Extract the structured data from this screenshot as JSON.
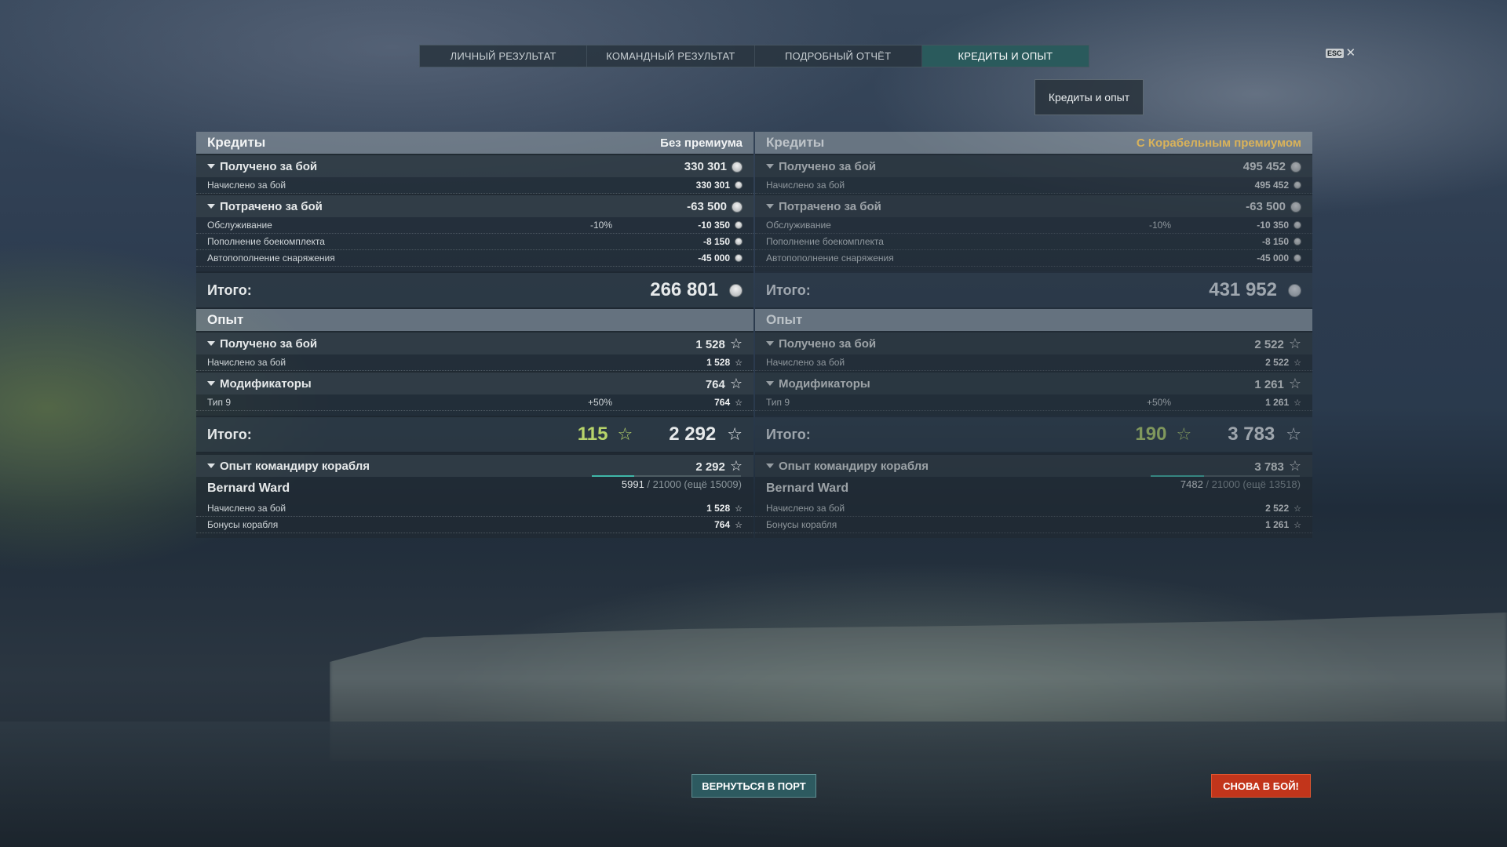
{
  "tabs": [
    "ЛИЧНЫЙ РЕЗУЛЬТАТ",
    "КОМАНДНЫЙ РЕЗУЛЬТАТ",
    "ПОДРОБНЫЙ ОТЧЁТ",
    "КРЕДИТЫ И ОПЫТ"
  ],
  "active_tab": "КРЕДИТЫ И ОПЫТ",
  "esc": {
    "key": "ESC",
    "close": "✕"
  },
  "chip": "Кредиты и опыт",
  "left": {
    "credits_title": "Кредиты",
    "mode": "Без премиума",
    "earned": {
      "label": "Получено за бой",
      "value": "330 301"
    },
    "earned_rows": [
      {
        "label": "Начислено за бой",
        "value": "330 301"
      }
    ],
    "spent": {
      "label": "Потрачено за бой",
      "value": "-63 500"
    },
    "spent_rows": [
      {
        "label": "Обслуживание",
        "pct": "-10%",
        "value": "-10 350"
      },
      {
        "label": "Пополнение боекомплекта",
        "pct": "",
        "value": "-8 150"
      },
      {
        "label": "Автопополнение снаряжения",
        "pct": "",
        "value": "-45 000"
      }
    ],
    "credits_total": {
      "label": "Итого:",
      "value": "266 801"
    },
    "xp_title": "Опыт",
    "xp_earned": {
      "label": "Получено за бой",
      "value": "1 528"
    },
    "xp_earned_rows": [
      {
        "label": "Начислено за бой",
        "value": "1 528"
      }
    ],
    "modifiers": {
      "label": "Модификаторы",
      "value": "764"
    },
    "modifier_rows": [
      {
        "label": "Тип 9",
        "pct": "+50%",
        "value": "764"
      }
    ],
    "xp_total": {
      "label": "Итого:",
      "free": "115",
      "value": "2 292"
    },
    "commander_xp": {
      "label": "Опыт командиру корабля",
      "value": "2 292"
    },
    "commander": {
      "name": "Bernard Ward",
      "current": "5991",
      "rest": " / 21000 (ещё 15009)",
      "progress": 0.285
    },
    "commander_rows": [
      {
        "label": "Начислено за бой",
        "value": "1 528"
      },
      {
        "label": "Бонусы корабля",
        "value": "764"
      }
    ]
  },
  "right": {
    "credits_title": "Кредиты",
    "mode": "С Корабельным премиумом",
    "earned": {
      "label": "Получено за бой",
      "value": "495 452"
    },
    "earned_rows": [
      {
        "label": "Начислено за бой",
        "value": "495 452"
      }
    ],
    "spent": {
      "label": "Потрачено за бой",
      "value": "-63 500"
    },
    "spent_rows": [
      {
        "label": "Обслуживание",
        "pct": "-10%",
        "value": "-10 350"
      },
      {
        "label": "Пополнение боекомплекта",
        "pct": "",
        "value": "-8 150"
      },
      {
        "label": "Автопополнение снаряжения",
        "pct": "",
        "value": "-45 000"
      }
    ],
    "credits_total": {
      "label": "Итого:",
      "value": "431 952"
    },
    "xp_title": "Опыт",
    "xp_earned": {
      "label": "Получено за бой",
      "value": "2 522"
    },
    "xp_earned_rows": [
      {
        "label": "Начислено за бой",
        "value": "2 522"
      }
    ],
    "modifiers": {
      "label": "Модификаторы",
      "value": "1 261"
    },
    "modifier_rows": [
      {
        "label": "Тип 9",
        "pct": "+50%",
        "value": "1 261"
      }
    ],
    "xp_total": {
      "label": "Итого:",
      "free": "190",
      "value": "3 783"
    },
    "commander_xp": {
      "label": "Опыт командиру корабля",
      "value": "3 783"
    },
    "commander": {
      "name": "Bernard Ward",
      "current": "7482",
      "rest": " / 21000 (ещё 13518)",
      "progress": 0.356
    },
    "commander_rows": [
      {
        "label": "Начислено за бой",
        "value": "2 522"
      },
      {
        "label": "Бонусы корабля",
        "value": "1 261"
      }
    ]
  },
  "buttons": {
    "port": "ВЕРНУТЬСЯ В ПОРТ",
    "again": "СНОВА В БОЙ!"
  },
  "icons": {
    "credit": "coin-icon",
    "xp": "star-icon",
    "expand": "triangle-down-icon"
  },
  "colors": {
    "active_tab": "#2a5a5c",
    "premium_gold": "#d9b25a",
    "free_xp": "#b7d46a",
    "battle_button": "#c2351b",
    "port_button": "#2d5a60"
  }
}
